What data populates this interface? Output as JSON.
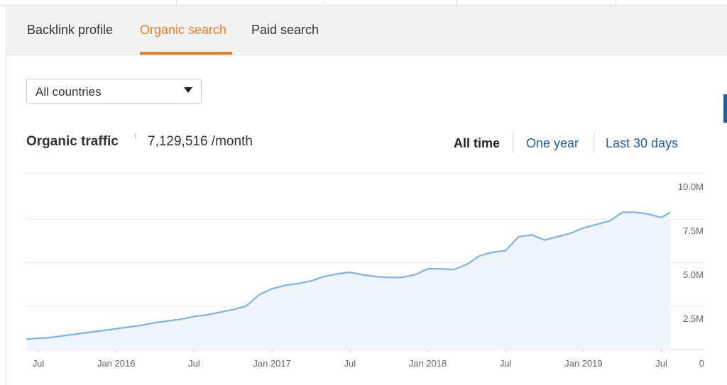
{
  "tabs": [
    {
      "label": "Backlink profile",
      "active": false
    },
    {
      "label": "Organic search",
      "active": true
    },
    {
      "label": "Paid search",
      "active": false
    }
  ],
  "country_select": {
    "value": "All countries"
  },
  "metric": {
    "label": "Organic traffic",
    "info": "i",
    "value": "7,129,516 /month"
  },
  "ranges": [
    {
      "label": "All time",
      "active": true
    },
    {
      "label": "One year",
      "active": false
    },
    {
      "label": "Last 30 days",
      "active": false
    }
  ],
  "colors": {
    "accent": "#f57c1e",
    "link": "#1f5ea8",
    "line": "#7db4e6",
    "area": "#eef5fd"
  },
  "chart_data": {
    "type": "area",
    "title": "",
    "xlabel": "",
    "ylabel": "",
    "x_ticks": [
      "Jul",
      "Jan 2016",
      "Jul",
      "Jan 2017",
      "Jul",
      "Jan 2018",
      "Jul",
      "Jan 2019",
      "Jul"
    ],
    "y_ticks": [
      "10.0M",
      "7.5M",
      "5.0M",
      "2.5M",
      "0"
    ],
    "ylim": [
      0,
      10000000
    ],
    "grid": true,
    "series": [
      {
        "x": [
          "2015-06",
          "2015-07",
          "2015-08",
          "2015-09",
          "2015-10",
          "2015-11",
          "2015-12",
          "2016-01",
          "2016-02",
          "2016-03",
          "2016-04",
          "2016-05",
          "2016-06",
          "2016-07",
          "2016-08",
          "2016-09",
          "2016-10",
          "2016-11",
          "2016-12",
          "2017-01",
          "2017-02",
          "2017-03",
          "2017-04",
          "2017-05",
          "2017-06",
          "2017-07",
          "2017-08",
          "2017-09",
          "2017-10",
          "2017-11",
          "2017-12",
          "2018-01",
          "2018-02",
          "2018-03",
          "2018-04",
          "2018-05",
          "2018-06",
          "2018-07",
          "2018-08",
          "2018-09",
          "2018-10",
          "2018-11",
          "2018-12",
          "2019-01",
          "2019-02",
          "2019-03",
          "2019-04",
          "2019-05",
          "2019-06",
          "2019-07",
          "2019-08"
        ],
        "values": [
          600000,
          650000,
          700000,
          800000,
          900000,
          1000000,
          1100000,
          1200000,
          1300000,
          1400000,
          1550000,
          1650000,
          1750000,
          1900000,
          2000000,
          2150000,
          2300000,
          2500000,
          3150000,
          3500000,
          3700000,
          3800000,
          3950000,
          4200000,
          4350000,
          4450000,
          4300000,
          4200000,
          4150000,
          4150000,
          4300000,
          4650000,
          4650000,
          4600000,
          4900000,
          5400000,
          5600000,
          5700000,
          6500000,
          6600000,
          6300000,
          6500000,
          6700000,
          7000000,
          7200000,
          7400000,
          7900000,
          7900000,
          7800000,
          7600000,
          7900000
        ]
      }
    ]
  }
}
